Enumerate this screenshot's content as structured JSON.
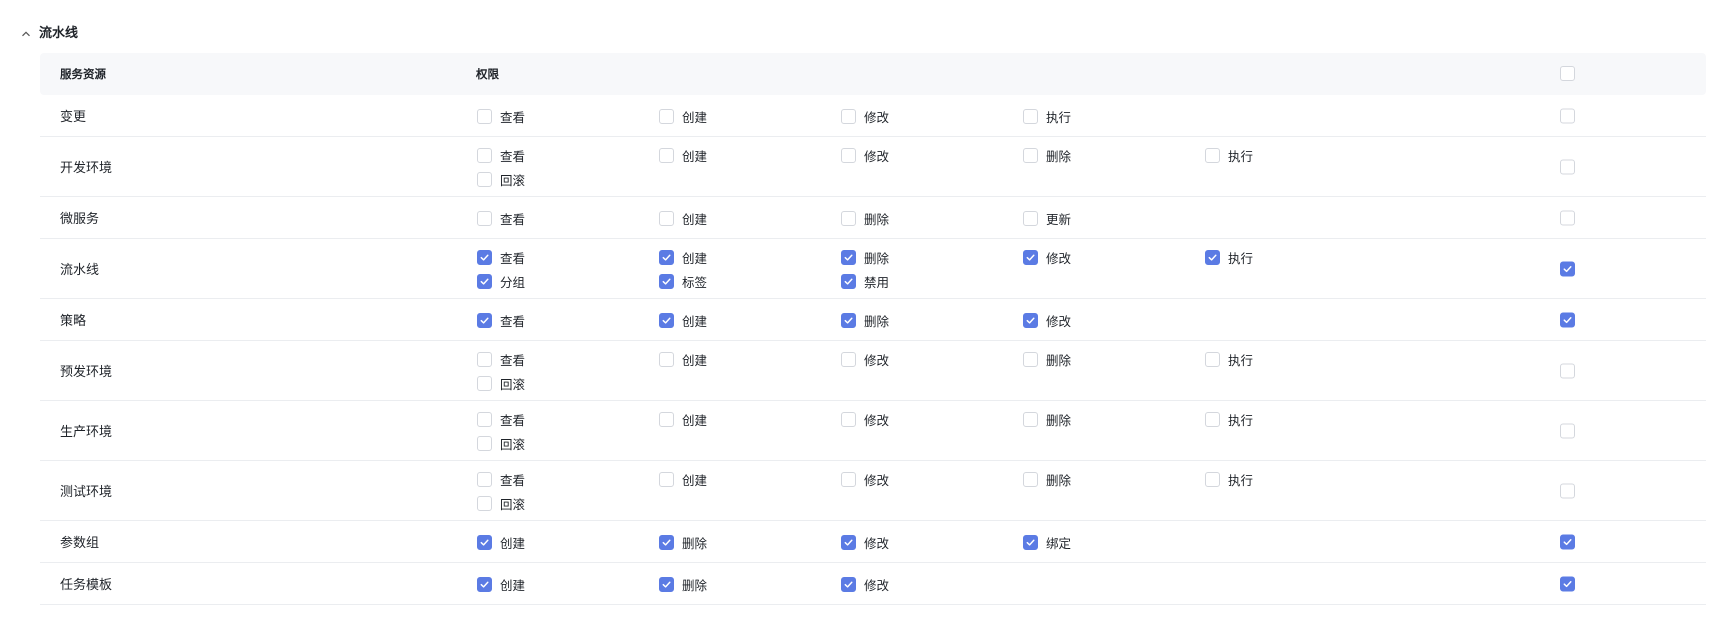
{
  "section": {
    "title": "流水线",
    "icon": "chevron-up-icon"
  },
  "table": {
    "headers": {
      "resource": "服务资源",
      "permission": "权限"
    },
    "select_all_checked": false,
    "accent_color": "#5b7be4",
    "rows": [
      {
        "name": "变更",
        "all": false,
        "perms": [
          {
            "label": "查看",
            "checked": false
          },
          {
            "label": "创建",
            "checked": false
          },
          {
            "label": "修改",
            "checked": false
          },
          {
            "label": "执行",
            "checked": false
          }
        ]
      },
      {
        "name": "开发环境",
        "all": false,
        "perms": [
          {
            "label": "查看",
            "checked": false
          },
          {
            "label": "创建",
            "checked": false
          },
          {
            "label": "修改",
            "checked": false
          },
          {
            "label": "删除",
            "checked": false
          },
          {
            "label": "执行",
            "checked": false
          },
          {
            "label": "回滚",
            "checked": false
          }
        ]
      },
      {
        "name": "微服务",
        "all": false,
        "perms": [
          {
            "label": "查看",
            "checked": false
          },
          {
            "label": "创建",
            "checked": false
          },
          {
            "label": "删除",
            "checked": false
          },
          {
            "label": "更新",
            "checked": false
          }
        ]
      },
      {
        "name": "流水线",
        "all": true,
        "perms": [
          {
            "label": "查看",
            "checked": true
          },
          {
            "label": "创建",
            "checked": true
          },
          {
            "label": "删除",
            "checked": true
          },
          {
            "label": "修改",
            "checked": true
          },
          {
            "label": "执行",
            "checked": true
          },
          {
            "label": "分组",
            "checked": true
          },
          {
            "label": "标签",
            "checked": true
          },
          {
            "label": "禁用",
            "checked": true
          }
        ]
      },
      {
        "name": "策略",
        "all": true,
        "perms": [
          {
            "label": "查看",
            "checked": true
          },
          {
            "label": "创建",
            "checked": true
          },
          {
            "label": "删除",
            "checked": true
          },
          {
            "label": "修改",
            "checked": true
          }
        ]
      },
      {
        "name": "预发环境",
        "all": false,
        "perms": [
          {
            "label": "查看",
            "checked": false
          },
          {
            "label": "创建",
            "checked": false
          },
          {
            "label": "修改",
            "checked": false
          },
          {
            "label": "删除",
            "checked": false
          },
          {
            "label": "执行",
            "checked": false
          },
          {
            "label": "回滚",
            "checked": false
          }
        ]
      },
      {
        "name": "生产环境",
        "all": false,
        "perms": [
          {
            "label": "查看",
            "checked": false
          },
          {
            "label": "创建",
            "checked": false
          },
          {
            "label": "修改",
            "checked": false
          },
          {
            "label": "删除",
            "checked": false
          },
          {
            "label": "执行",
            "checked": false
          },
          {
            "label": "回滚",
            "checked": false
          }
        ]
      },
      {
        "name": "测试环境",
        "all": false,
        "perms": [
          {
            "label": "查看",
            "checked": false
          },
          {
            "label": "创建",
            "checked": false
          },
          {
            "label": "修改",
            "checked": false
          },
          {
            "label": "删除",
            "checked": false
          },
          {
            "label": "执行",
            "checked": false
          },
          {
            "label": "回滚",
            "checked": false
          }
        ]
      },
      {
        "name": "参数组",
        "all": true,
        "perms": [
          {
            "label": "创建",
            "checked": true
          },
          {
            "label": "删除",
            "checked": true
          },
          {
            "label": "修改",
            "checked": true
          },
          {
            "label": "绑定",
            "checked": true
          }
        ]
      },
      {
        "name": "任务模板",
        "all": true,
        "perms": [
          {
            "label": "创建",
            "checked": true
          },
          {
            "label": "删除",
            "checked": true
          },
          {
            "label": "修改",
            "checked": true
          }
        ]
      }
    ]
  }
}
